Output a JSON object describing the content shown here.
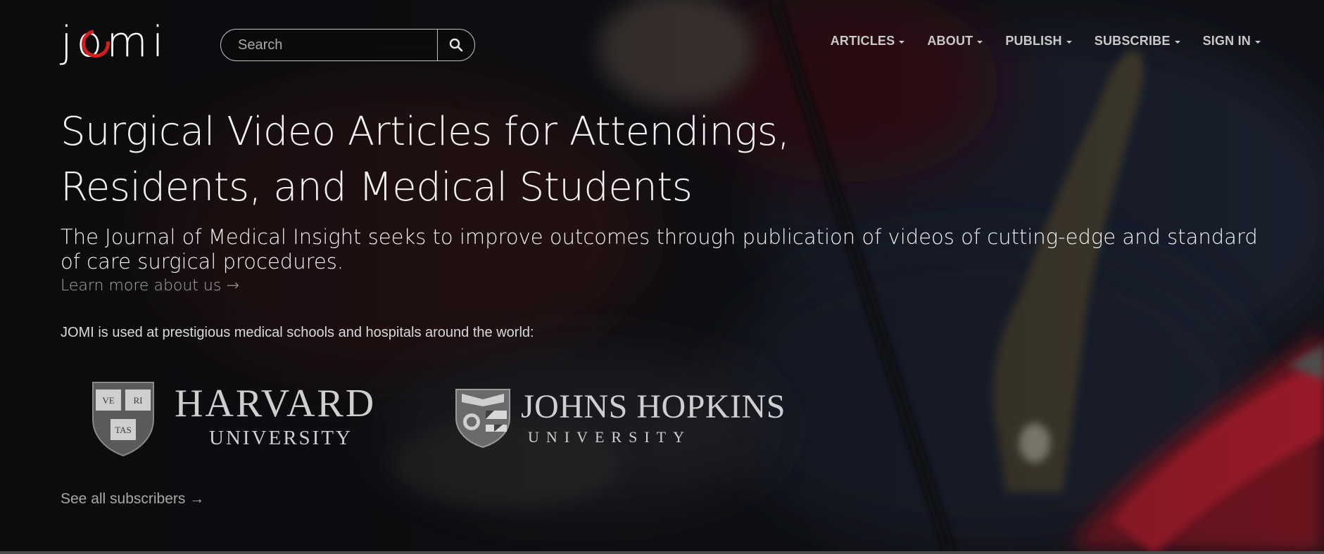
{
  "brand": {
    "logo_text": "jomi",
    "accent": "#d41e1e"
  },
  "search": {
    "placeholder": "Search",
    "value": "",
    "icon": "search-icon"
  },
  "nav": {
    "items": [
      {
        "label": "ARTICLES"
      },
      {
        "label": "ABOUT"
      },
      {
        "label": "PUBLISH"
      },
      {
        "label": "SUBSCRIBE"
      },
      {
        "label": "SIGN IN"
      }
    ],
    "dropdown_icon": "caret-down-icon"
  },
  "hero": {
    "headline_line1": "Surgical Video Articles for Attendings,",
    "headline_line2": "Residents, and Medical Students",
    "tagline": "The Journal of Medical Insight seeks to improve outcomes through publication of videos of cutting-edge and standard of care surgical procedures.",
    "learn_more": "Learn more about us →"
  },
  "institutions": {
    "intro": "JOMI is used at prestigious medical schools and hospitals around the world:",
    "logos": [
      {
        "name": "HARVARD",
        "subtitle": "UNIVERSITY",
        "shield_text": [
          "VE",
          "RI",
          "TAS"
        ]
      },
      {
        "name": "JOHNS HOPKINS",
        "subtitle": "UNIVERSITY"
      }
    ],
    "see_all": "See all subscribers →"
  }
}
